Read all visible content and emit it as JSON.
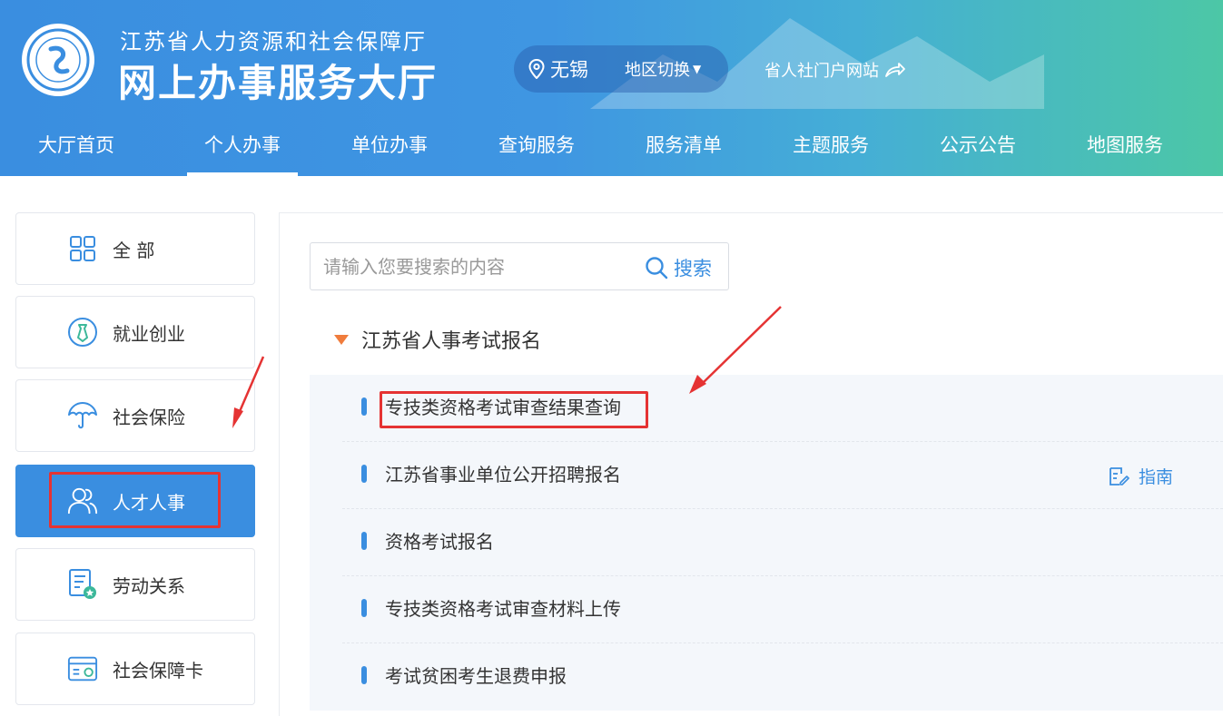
{
  "header": {
    "subtitle": "江苏省人力资源和社会保障厅",
    "title": "网上办事服务大厅",
    "region": {
      "city": "无锡",
      "switch_label": "地区切换"
    },
    "portal_link": "省人社门户网站"
  },
  "nav": {
    "items": [
      {
        "label": "大厅首页"
      },
      {
        "label": "个人办事"
      },
      {
        "label": "单位办事"
      },
      {
        "label": "查询服务"
      },
      {
        "label": "服务清单"
      },
      {
        "label": "主题服务"
      },
      {
        "label": "公示公告"
      },
      {
        "label": "地图服务"
      }
    ],
    "active_index": 1
  },
  "sidebar": {
    "items": [
      {
        "label": "全 部",
        "icon": "grid-icon"
      },
      {
        "label": "就业创业",
        "icon": "tie-icon"
      },
      {
        "label": "社会保险",
        "icon": "umbrella-icon"
      },
      {
        "label": "人才人事",
        "icon": "people-icon"
      },
      {
        "label": "劳动关系",
        "icon": "contract-icon"
      },
      {
        "label": "社会保障卡",
        "icon": "card-icon"
      }
    ],
    "active_index": 3
  },
  "search": {
    "placeholder": "请输入您要搜索的内容",
    "button_label": "搜索"
  },
  "group": {
    "title": "江苏省人事考试报名",
    "items": [
      {
        "label": "专技类资格考试审查结果查询",
        "guide": ""
      },
      {
        "label": "江苏省事业单位公开招聘报名",
        "guide": "指南"
      },
      {
        "label": "资格考试报名",
        "guide": ""
      },
      {
        "label": "专技类资格考试审查材料上传",
        "guide": ""
      },
      {
        "label": "考试贫困考生退费申报",
        "guide": ""
      }
    ]
  },
  "colors": {
    "primary": "#3a8ee0",
    "accent_orange": "#f07c3c",
    "annotation_red": "#e53333",
    "header_green": "#4cc7a6"
  }
}
